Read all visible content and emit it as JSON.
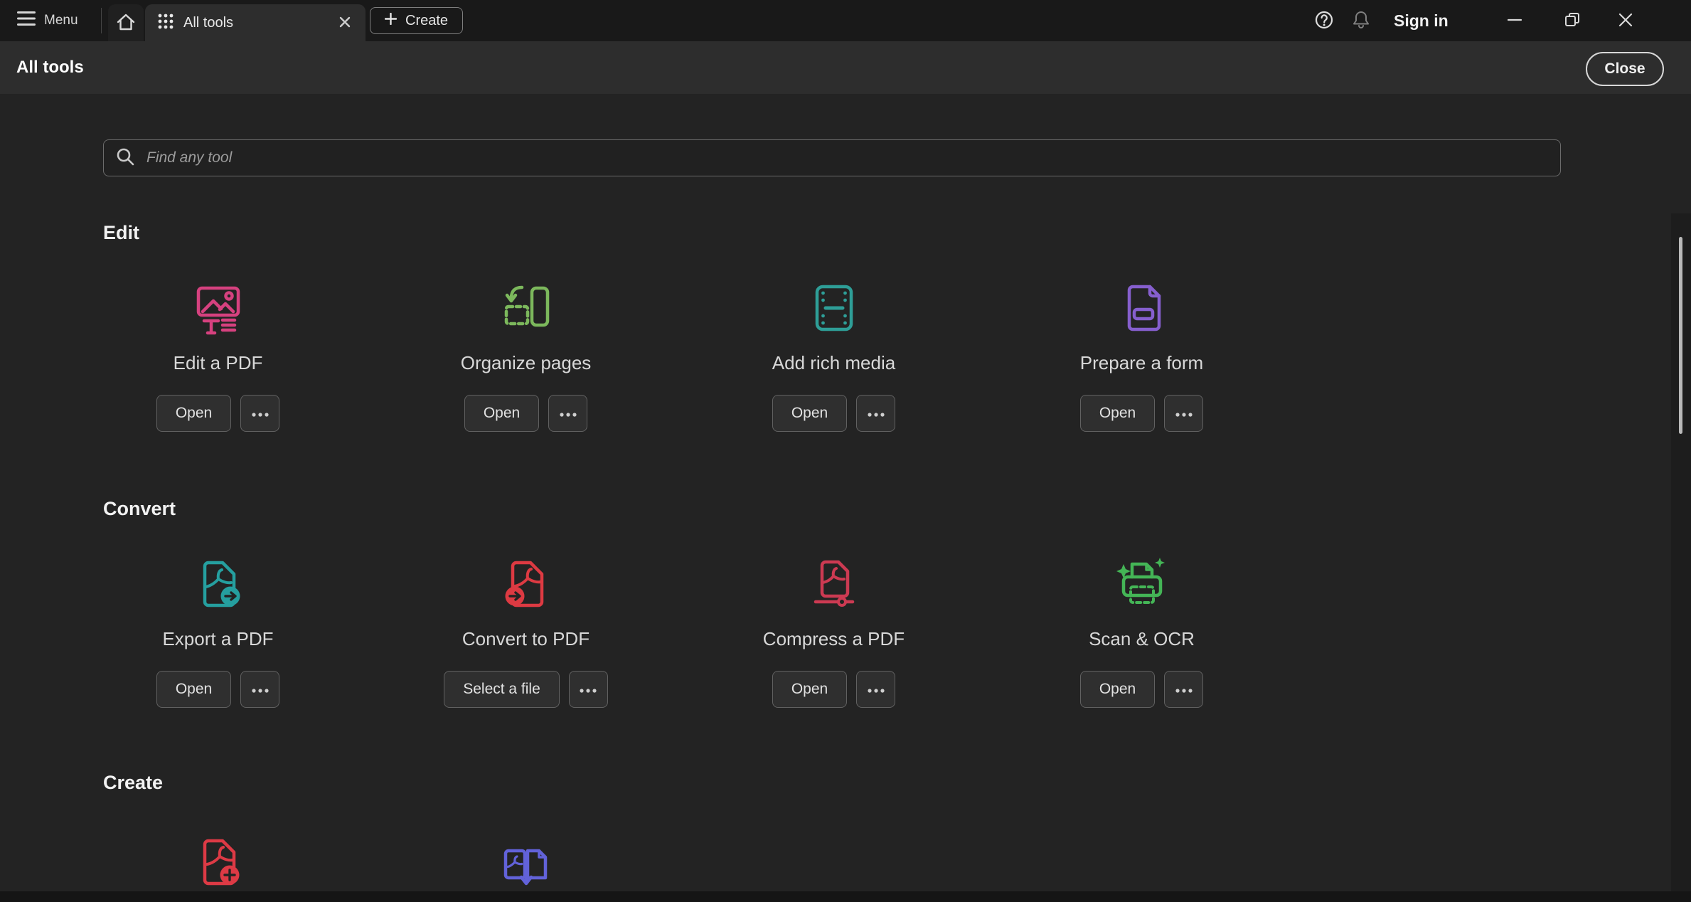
{
  "titlebar": {
    "menu": "Menu",
    "active_tab": "All tools",
    "create": "Create",
    "sign_in": "Sign in"
  },
  "header": {
    "title": "All tools",
    "close": "Close"
  },
  "search": {
    "placeholder": "Find any tool"
  },
  "sections": [
    {
      "label": "Edit",
      "tools": [
        {
          "name": "Edit a PDF",
          "action": "Open",
          "icon": "edit-pdf-icon",
          "color": "#d6417f"
        },
        {
          "name": "Organize pages",
          "action": "Open",
          "icon": "organize-pages-icon",
          "color": "#7cb85c"
        },
        {
          "name": "Add rich media",
          "action": "Open",
          "icon": "rich-media-icon",
          "color": "#2e9e97"
        },
        {
          "name": "Prepare a form",
          "action": "Open",
          "icon": "prepare-form-icon",
          "color": "#865fce"
        }
      ]
    },
    {
      "label": "Convert",
      "tools": [
        {
          "name": "Export a PDF",
          "action": "Open",
          "icon": "export-pdf-icon",
          "color": "#259f9f"
        },
        {
          "name": "Convert to PDF",
          "action": "Select a file",
          "icon": "convert-pdf-icon",
          "color": "#dd3a42"
        },
        {
          "name": "Compress a PDF",
          "action": "Open",
          "icon": "compress-pdf-icon",
          "color": "#cc3a52"
        },
        {
          "name": "Scan & OCR",
          "action": "Open",
          "icon": "scan-ocr-icon",
          "color": "#44b556"
        }
      ]
    },
    {
      "label": "Create",
      "tools": [
        {
          "icon": "create-pdf-icon",
          "color": "#dd3a45"
        },
        {
          "icon": "combine-files-icon",
          "color": "#6262d9"
        }
      ]
    }
  ]
}
